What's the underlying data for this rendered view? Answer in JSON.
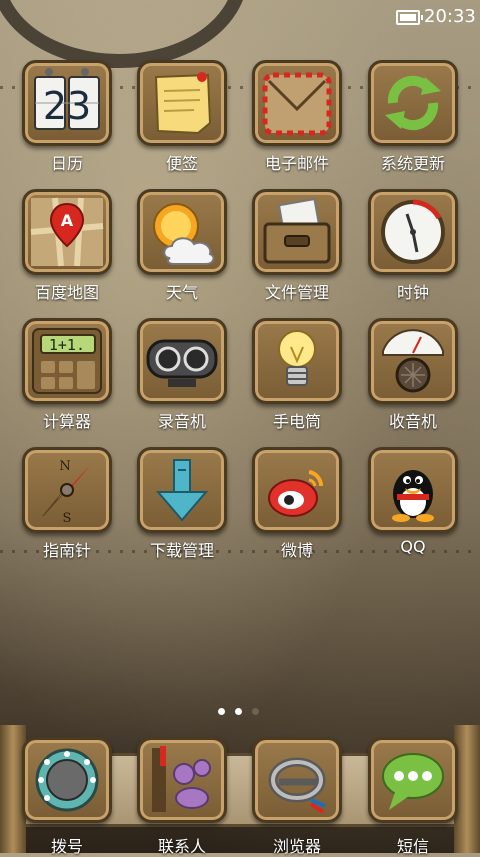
{
  "status_bar": {
    "time": "20:33",
    "battery_icon": "battery-icon"
  },
  "apps": [
    {
      "label": "日历",
      "icon": "calendar-icon",
      "calendar_digits": "23"
    },
    {
      "label": "便签",
      "icon": "note-icon"
    },
    {
      "label": "电子邮件",
      "icon": "email-icon"
    },
    {
      "label": "系统更新",
      "icon": "refresh-icon"
    },
    {
      "label": "百度地图",
      "icon": "map-icon",
      "map_pin_letter": "A"
    },
    {
      "label": "天气",
      "icon": "weather-icon"
    },
    {
      "label": "文件管理",
      "icon": "folder-icon"
    },
    {
      "label": "时钟",
      "icon": "clock-icon"
    },
    {
      "label": "计算器",
      "icon": "calculator-icon",
      "calc_display": "1+1."
    },
    {
      "label": "录音机",
      "icon": "recorder-icon"
    },
    {
      "label": "手电筒",
      "icon": "flashlight-icon"
    },
    {
      "label": "收音机",
      "icon": "radio-icon"
    },
    {
      "label": "指南针",
      "icon": "compass-icon",
      "compass_n": "N",
      "compass_s": "S"
    },
    {
      "label": "下载管理",
      "icon": "download-icon"
    },
    {
      "label": "微博",
      "icon": "weibo-icon"
    },
    {
      "label": "QQ",
      "icon": "qq-icon"
    }
  ],
  "page_indicator": {
    "total": 3,
    "active": 1
  },
  "dock": [
    {
      "label": "拨号",
      "icon": "phone-dial-icon"
    },
    {
      "label": "联系人",
      "icon": "contacts-icon"
    },
    {
      "label": "浏览器",
      "icon": "browser-icon"
    },
    {
      "label": "短信",
      "icon": "message-icon"
    }
  ],
  "colors": {
    "tile_brown": "#8a6a3f",
    "label_text": "#ffffff",
    "accent_green": "#79c043",
    "accent_red": "#d6281e"
  }
}
